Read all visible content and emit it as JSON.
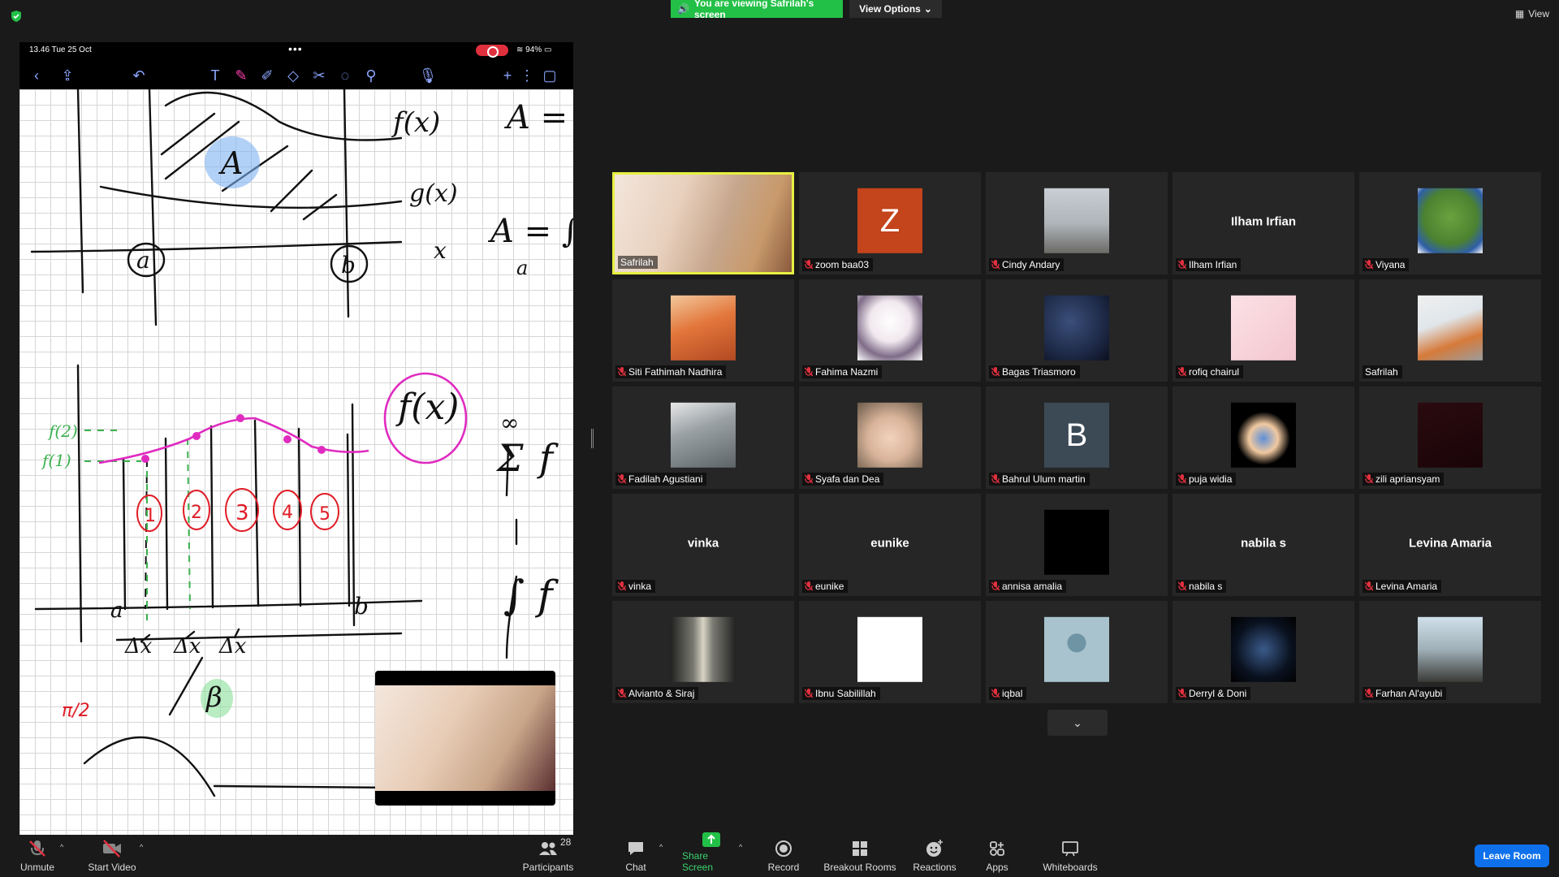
{
  "banner": {
    "viewing": "You are viewing Safrilah's screen",
    "view_options": "View Options",
    "view": "View"
  },
  "shared_screen": {
    "status_time": "13.46  Tue 25 Oct",
    "status_dots": "•••",
    "battery": "94%",
    "handwriting": {
      "fx": "f(x)",
      "gx": "g(x)",
      "x": "x",
      "A": "A",
      "a": "a",
      "b": "b",
      "A_eq": "A =",
      "A_int": "A = ∫",
      "a2": "a",
      "f2": "f(2)",
      "f1": "f(1)",
      "fx2": "f(x)",
      "n1": "1",
      "n2": "2",
      "n3": "3",
      "n4": "4",
      "n5": "5",
      "dx": "Δx",
      "sigma": "Σ",
      "inf": "∞",
      "int_f": "∫ f",
      "sum_f": "f",
      "pi2": "π/2",
      "beta": "β",
      "two": "2",
      "a3": "a",
      "b3": "b"
    }
  },
  "participants": [
    {
      "name": "Safrilah",
      "type": "video",
      "muted": false,
      "active": true
    },
    {
      "name": "zoom baa03",
      "type": "letter",
      "letter": "Z",
      "color": "#c4441b",
      "muted": true
    },
    {
      "name": "Cindy Andary",
      "type": "photo",
      "muted": true
    },
    {
      "name": "Ilham Irfian",
      "type": "text",
      "muted": true
    },
    {
      "name": "Viyana",
      "type": "photo",
      "muted": true
    },
    {
      "name": "Siti Fathimah Nadhira",
      "type": "photo",
      "muted": true
    },
    {
      "name": "Fahima Nazmi",
      "type": "photo",
      "muted": true
    },
    {
      "name": "Bagas Triasmoro",
      "type": "photo",
      "muted": true
    },
    {
      "name": "rofiq chairul",
      "type": "photo",
      "muted": true
    },
    {
      "name": "Safrilah",
      "type": "photo",
      "muted": false
    },
    {
      "name": "Fadilah Agustiani",
      "type": "photo",
      "muted": true
    },
    {
      "name": "Syafa dan Dea",
      "type": "photo",
      "muted": true
    },
    {
      "name": "Bahrul Ulum martin",
      "type": "letter",
      "letter": "B",
      "color": "#3c4a56",
      "muted": true
    },
    {
      "name": "puja widia",
      "type": "photo",
      "muted": true
    },
    {
      "name": "zili apriansyam",
      "type": "photo",
      "muted": true
    },
    {
      "name": "vinka",
      "type": "text",
      "muted": true
    },
    {
      "name": "eunike",
      "type": "text",
      "muted": true
    },
    {
      "name": "annisa amalia",
      "type": "photo",
      "muted": true
    },
    {
      "name": "nabila s",
      "type": "text",
      "muted": true
    },
    {
      "name": "Levina Amaria",
      "type": "text",
      "muted": true
    },
    {
      "name": "Alvianto & Siraj",
      "type": "photo",
      "muted": true
    },
    {
      "name": "Ibnu Sabilillah",
      "type": "photo",
      "muted": true
    },
    {
      "name": "iqbal",
      "type": "photo",
      "muted": true
    },
    {
      "name": "Derryl & Doni",
      "type": "photo",
      "muted": true
    },
    {
      "name": "Farhan Al'ayubi",
      "type": "photo",
      "muted": true
    }
  ],
  "controls": {
    "unmute": "Unmute",
    "start_video": "Start Video",
    "participants": "Participants",
    "participants_count": "28",
    "chat": "Chat",
    "share_screen": "Share Screen",
    "record": "Record",
    "breakout_rooms": "Breakout Rooms",
    "reactions": "Reactions",
    "apps": "Apps",
    "whiteboards": "Whiteboards",
    "leave_room": "Leave Room"
  },
  "colors": {
    "banner_green": "#23c047",
    "active_speaker": "#e6f040",
    "leave_blue": "#0e71eb",
    "muted_red": "#e0303e"
  }
}
